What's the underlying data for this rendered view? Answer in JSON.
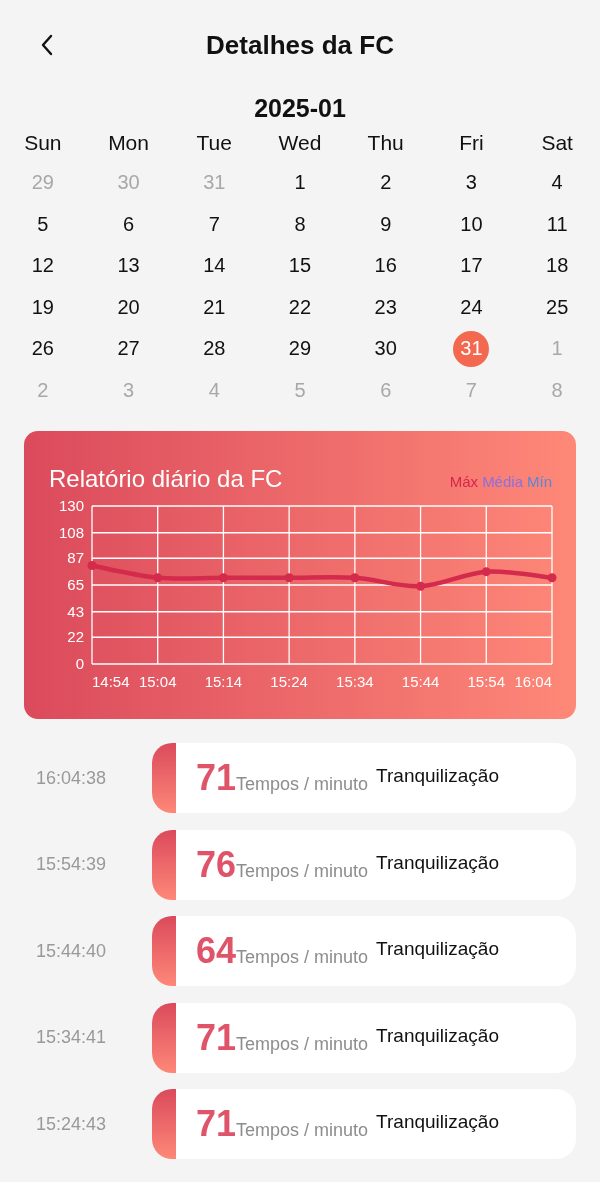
{
  "header": {
    "title": "Detalhes da FC"
  },
  "calendar": {
    "month": "2025-01",
    "weekdays": [
      "Sun",
      "Mon",
      "Tue",
      "Wed",
      "Thu",
      "Fri",
      "Sat"
    ],
    "weeks": [
      [
        {
          "day": "29",
          "muted": true,
          "selected": false
        },
        {
          "day": "30",
          "muted": true,
          "selected": false
        },
        {
          "day": "31",
          "muted": true,
          "selected": false
        },
        {
          "day": "1",
          "muted": false,
          "selected": false
        },
        {
          "day": "2",
          "muted": false,
          "selected": false
        },
        {
          "day": "3",
          "muted": false,
          "selected": false
        },
        {
          "day": "4",
          "muted": false,
          "selected": false
        }
      ],
      [
        {
          "day": "5",
          "muted": false,
          "selected": false
        },
        {
          "day": "6",
          "muted": false,
          "selected": false
        },
        {
          "day": "7",
          "muted": false,
          "selected": false
        },
        {
          "day": "8",
          "muted": false,
          "selected": false
        },
        {
          "day": "9",
          "muted": false,
          "selected": false
        },
        {
          "day": "10",
          "muted": false,
          "selected": false
        },
        {
          "day": "11",
          "muted": false,
          "selected": false
        }
      ],
      [
        {
          "day": "12",
          "muted": false,
          "selected": false
        },
        {
          "day": "13",
          "muted": false,
          "selected": false
        },
        {
          "day": "14",
          "muted": false,
          "selected": false
        },
        {
          "day": "15",
          "muted": false,
          "selected": false
        },
        {
          "day": "16",
          "muted": false,
          "selected": false
        },
        {
          "day": "17",
          "muted": false,
          "selected": false
        },
        {
          "day": "18",
          "muted": false,
          "selected": false
        }
      ],
      [
        {
          "day": "19",
          "muted": false,
          "selected": false
        },
        {
          "day": "20",
          "muted": false,
          "selected": false
        },
        {
          "day": "21",
          "muted": false,
          "selected": false
        },
        {
          "day": "22",
          "muted": false,
          "selected": false
        },
        {
          "day": "23",
          "muted": false,
          "selected": false
        },
        {
          "day": "24",
          "muted": false,
          "selected": false
        },
        {
          "day": "25",
          "muted": false,
          "selected": false
        }
      ],
      [
        {
          "day": "26",
          "muted": false,
          "selected": false
        },
        {
          "day": "27",
          "muted": false,
          "selected": false
        },
        {
          "day": "28",
          "muted": false,
          "selected": false
        },
        {
          "day": "29",
          "muted": false,
          "selected": false
        },
        {
          "day": "30",
          "muted": false,
          "selected": false
        },
        {
          "day": "31",
          "muted": false,
          "selected": true
        },
        {
          "day": "1",
          "muted": true,
          "selected": false
        }
      ],
      [
        {
          "day": "2",
          "muted": true,
          "selected": false
        },
        {
          "day": "3",
          "muted": true,
          "selected": false
        },
        {
          "day": "4",
          "muted": true,
          "selected": false
        },
        {
          "day": "5",
          "muted": true,
          "selected": false
        },
        {
          "day": "6",
          "muted": true,
          "selected": false
        },
        {
          "day": "7",
          "muted": true,
          "selected": false
        },
        {
          "day": "8",
          "muted": true,
          "selected": false
        }
      ]
    ]
  },
  "report": {
    "title": "Relatório diário da FC",
    "legend": [
      {
        "label": "Máx",
        "color": "#d7264a"
      },
      {
        "label": "Média",
        "color": "#8a6fe0"
      },
      {
        "label": "Mín",
        "color": "#5b86d6"
      }
    ],
    "chart_data": {
      "type": "line",
      "categories": [
        "14:54",
        "15:04",
        "15:14",
        "15:24",
        "15:34",
        "15:44",
        "15:54",
        "16:04"
      ],
      "series": [
        {
          "color": "#d42a4c",
          "marker": true,
          "values": [
            81,
            71,
            71,
            71,
            71,
            64,
            76,
            71
          ]
        }
      ],
      "ylim": [
        0,
        130
      ],
      "yticks": [
        0,
        22,
        43,
        65,
        87,
        108,
        130
      ],
      "grid": true
    }
  },
  "records": [
    {
      "time": "16:04:38",
      "value": "71",
      "unit": "Tempos / minuto",
      "status": "Tranquilização"
    },
    {
      "time": "15:54:39",
      "value": "76",
      "unit": "Tempos / minuto",
      "status": "Tranquilização"
    },
    {
      "time": "15:44:40",
      "value": "64",
      "unit": "Tempos / minuto",
      "status": "Tranquilização"
    },
    {
      "time": "15:34:41",
      "value": "71",
      "unit": "Tempos / minuto",
      "status": "Tranquilização"
    },
    {
      "time": "15:24:43",
      "value": "71",
      "unit": "Tempos / minuto",
      "status": "Tranquilização"
    }
  ]
}
